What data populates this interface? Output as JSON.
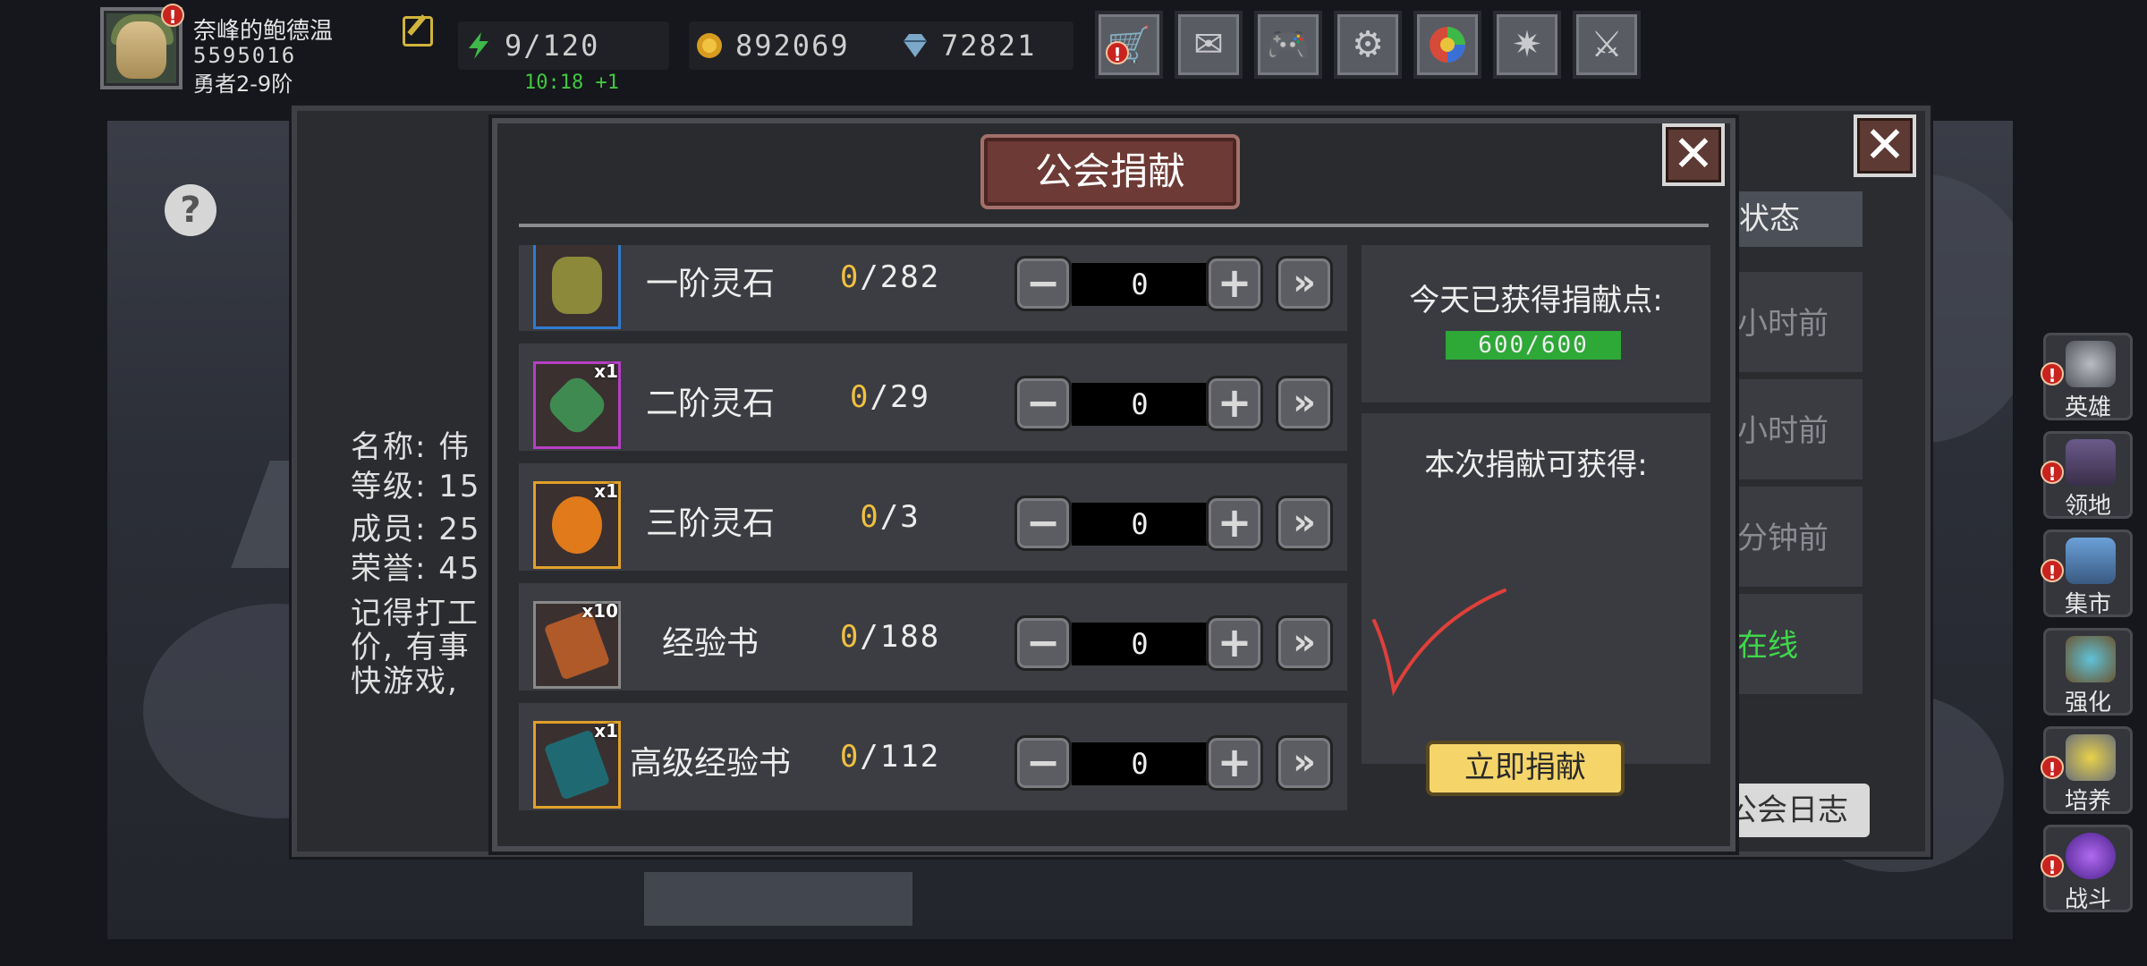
{
  "player": {
    "name": "奈峰的鲍德温",
    "id": "5595016",
    "rank": "勇者2-9阶",
    "alert": "!"
  },
  "resources": {
    "stamina": "9/120",
    "stamina_timer": "10:18 +1",
    "gold": "892069",
    "gems": "72821"
  },
  "toolbar": {
    "icons": [
      "cart-icon",
      "mail-icon",
      "gamepad-icon",
      "gear-icon",
      "palette-icon",
      "firework-icon",
      "swords-icon"
    ]
  },
  "side_menu": [
    {
      "label": "英雄",
      "icon": "hero-helmet-icon"
    },
    {
      "label": "领地",
      "icon": "territory-castle-icon"
    },
    {
      "label": "集市",
      "icon": "market-stall-icon"
    },
    {
      "label": "强化",
      "icon": "enhance-emblem-icon"
    },
    {
      "label": "培养",
      "icon": "cultivate-chalice-icon"
    },
    {
      "label": "战斗",
      "icon": "battle-portal-icon"
    }
  ],
  "guild_panel": {
    "help": "?",
    "info": {
      "name": "名称: 伟",
      "level": "等级: 15",
      "members": "成员: 25",
      "honor": "荣誉: 45",
      "notice_1": "记得打工",
      "notice_2": "价, 有事",
      "notice_3": "快游戏, "
    },
    "status_tab": "状态",
    "log_rows": [
      "小时前",
      "小时前",
      "分钟前",
      "在线"
    ],
    "log_button": "公会日志",
    "close": "✕"
  },
  "donate": {
    "title": "公会捐献",
    "close": "✕",
    "items": [
      {
        "name": "一阶灵石",
        "have": "0",
        "need": "/282",
        "qty": "0",
        "badge": "",
        "color": "#2f7bd0"
      },
      {
        "name": "二阶灵石",
        "have": "0",
        "need": "/29",
        "qty": "0",
        "badge": "x1",
        "color": "#b63fc4"
      },
      {
        "name": "三阶灵石",
        "have": "0",
        "need": "/3",
        "qty": "0",
        "badge": "x1",
        "color": "#e0a12a"
      },
      {
        "name": "经验书",
        "have": "0",
        "need": "/188",
        "qty": "0",
        "badge": "x10",
        "color": "#8a8a8a"
      },
      {
        "name": "高级经验书",
        "have": "0",
        "need": "/112",
        "qty": "0",
        "badge": "x1",
        "color": "#e0a12a"
      }
    ],
    "today_label": "今天已获得捐献点:",
    "today_progress": "600/600",
    "today_fraction": 1.0,
    "gain_label": "本次捐献可获得:",
    "button": "立即捐献",
    "colors": {
      "have": "#f0c040",
      "progress": "#2ea837",
      "button": "#f5d56a",
      "check": "#e0403a"
    }
  }
}
